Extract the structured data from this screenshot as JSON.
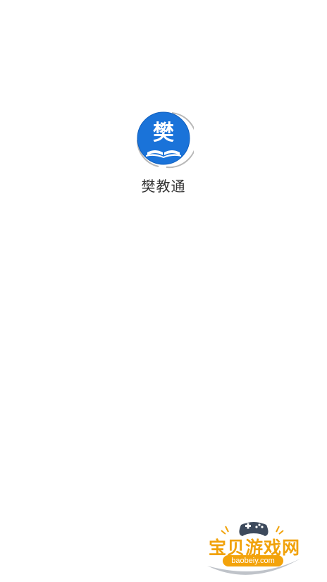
{
  "app": {
    "name": "樊教通",
    "logo_char": "樊",
    "logo_color": "#1a73d9"
  },
  "watermark": {
    "title": "宝贝游戏网",
    "domain": "baobeiy.com",
    "title_color": "#f1a20a"
  }
}
